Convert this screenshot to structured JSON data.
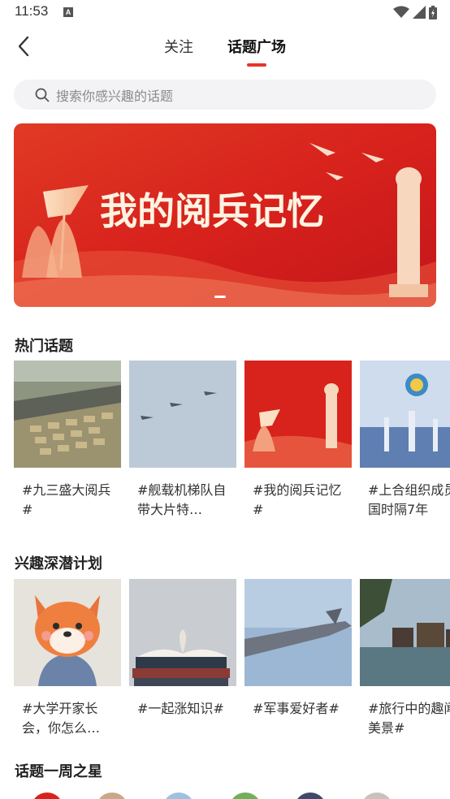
{
  "status_bar": {
    "time": "11:53",
    "notif_glyph": "A"
  },
  "header": {
    "back_icon": "chevron-left-icon",
    "tabs": [
      {
        "label": "关注"
      },
      {
        "label": "话题广场"
      }
    ],
    "active_tab_color": "#e8342a"
  },
  "search": {
    "placeholder": "搜索你感兴趣的话题"
  },
  "banner": {
    "title": "我的阅兵记忆"
  },
  "hot_topics": {
    "title": "热门话题",
    "items": [
      {
        "text": "#九三盛大阅兵#"
      },
      {
        "text": "#舰载机梯队自带大片特…"
      },
      {
        "text": "#我的阅兵记忆#"
      },
      {
        "text": "#上合组织成员国时隔7年"
      }
    ]
  },
  "interest_plan": {
    "title": "兴趣深潜计划",
    "items": [
      {
        "text": "#大学开家长会，你怎么…"
      },
      {
        "text": "#一起涨知识#"
      },
      {
        "text": "#军事爱好者#"
      },
      {
        "text": "#旅行中的趣闻美景#"
      }
    ]
  },
  "weekly_star": {
    "title": "话题一周之星"
  },
  "colors": {
    "accent": "#e8342a",
    "banner_red": "#d8221c",
    "search_bg": "#f3f3f5"
  }
}
